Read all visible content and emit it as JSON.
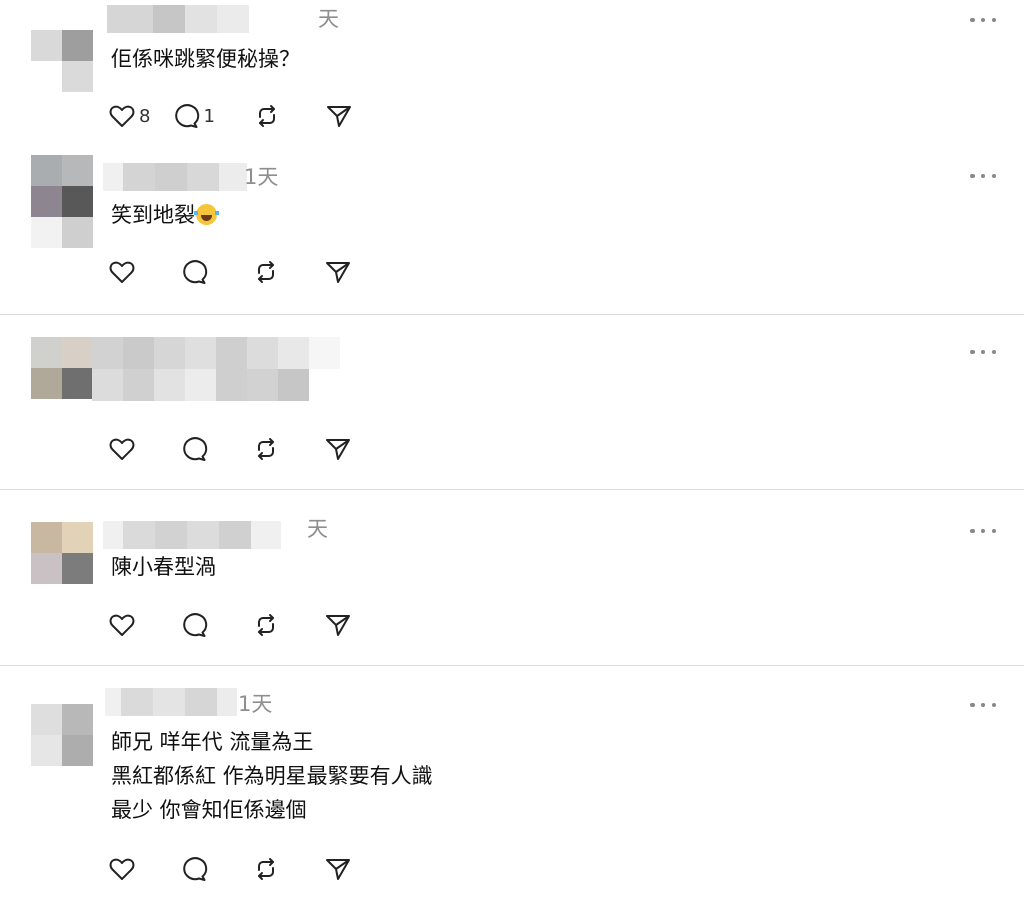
{
  "comments": [
    {
      "time": "天",
      "text": "佢係咪跳緊便秘操？",
      "likes": "8",
      "replies": "1"
    },
    {
      "time": "1天",
      "text": "笑到地裂",
      "emoji": "face-with-tears-of-joy"
    },
    {
      "time": "",
      "text": ""
    },
    {
      "time": "天",
      "text": "陳小春型渦"
    },
    {
      "time": "1天",
      "text": "師兄 咩年代 流量為王\n黑紅都係紅 作為明星最緊要有人識\n最少 你會知佢係邊個"
    }
  ],
  "icons": {
    "like": "heart-icon",
    "reply": "comment-bubble-icon",
    "repost": "repost-icon",
    "share": "send-icon",
    "more": "more-dots-icon"
  },
  "colors": {
    "text": "#111111",
    "muted": "#8e8e8e",
    "divider": "#dcdcdc"
  }
}
